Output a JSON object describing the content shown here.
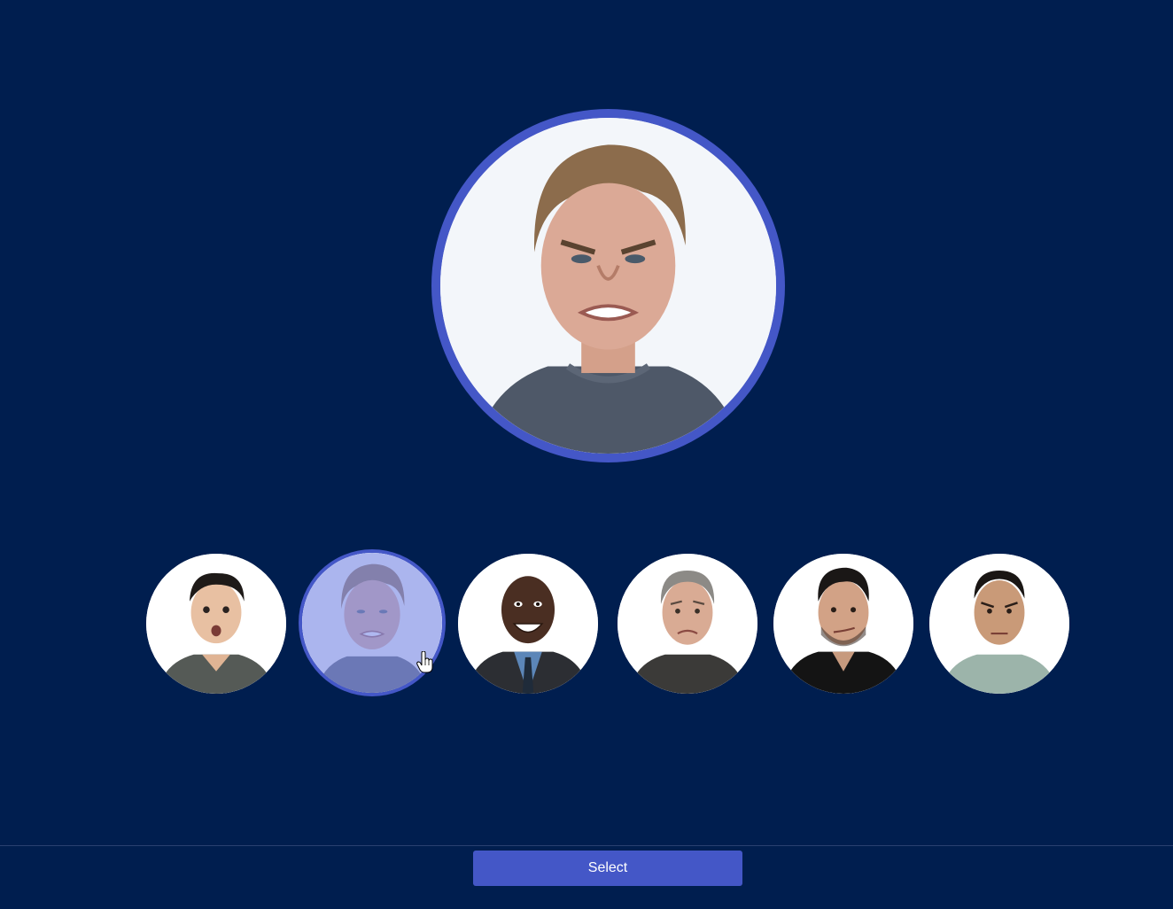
{
  "colors": {
    "background": "#001e4f",
    "accent": "#4457c7",
    "selected_overlay": "#7e8ce6",
    "divider": "#2a4170"
  },
  "preview": {
    "image": "selected-face-photo",
    "expression": "disgust"
  },
  "thumbnails": [
    {
      "image": "face-photo-1",
      "expression": "surprise",
      "selected": false
    },
    {
      "image": "face-photo-2",
      "expression": "disgust",
      "selected": true
    },
    {
      "image": "face-photo-3",
      "expression": "happiness",
      "selected": false
    },
    {
      "image": "face-photo-4",
      "expression": "sadness",
      "selected": false
    },
    {
      "image": "face-photo-5",
      "expression": "contempt",
      "selected": false
    },
    {
      "image": "face-photo-6",
      "expression": "anger",
      "selected": false
    }
  ],
  "cursor": {
    "icon": "hand-pointer-icon"
  },
  "footer": {
    "select_label": "Select"
  }
}
